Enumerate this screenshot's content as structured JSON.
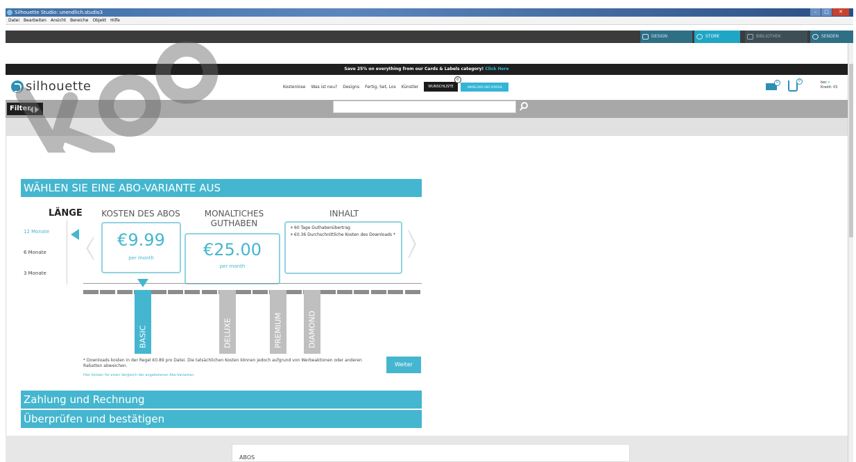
{
  "window": {
    "title": "Silhouette Studio: unendlich.studio3"
  },
  "menubar": [
    "Datei",
    "Bearbeiten",
    "Ansicht",
    "Bereiche",
    "Objekt",
    "Hilfe"
  ],
  "modules": {
    "design": "DESIGN",
    "store": "STORE",
    "library": "BIBLIOTHEK",
    "send": "SENDEN"
  },
  "promo": {
    "text": "Save 25% on everything from our Cards & Labels category!",
    "link": "Click Here"
  },
  "store_header": {
    "logo": "silhouette",
    "nav": [
      "Kostenlose",
      "Was ist neu?",
      "Designs",
      "Fertig, Set, Los",
      "Künstler"
    ],
    "wishlist_label": "WUNSCHLISTE",
    "wishlist_count": "0",
    "login_label": "ANMELDEN UND SPAREN",
    "mail_count": "0",
    "cart_count": "0",
    "user": "bec",
    "credit": "Kredit: €5"
  },
  "filterbar": {
    "filter_label": "Filter",
    "search_value": ""
  },
  "subscription": {
    "heading": "WÄHLEN SIE EINE ABO-VARIANTE AUS",
    "length_label": "LÄNGE",
    "months": [
      "12 Monate",
      "6 Monate",
      "3 Monate"
    ],
    "selected_month_index": 0,
    "col_cost": "KOSTEN DES ABOS",
    "col_monthly_line1": "MONALTICHES",
    "col_monthly_line2": "GUTHABEN",
    "col_content": "INHALT",
    "cost_value": "€9.99",
    "cost_unit": "per month",
    "credit_value": "€25.00",
    "credit_unit": "per month",
    "content_items": [
      "60 Tage Guthabenübertrag",
      "€0.36 Durchschnittliche Kosten des Downloads *"
    ],
    "plans": [
      "BASIC",
      "DELUXE",
      "PREMIUM",
      "DIAMOND"
    ],
    "selected_plan": "BASIC",
    "footnote": "* Downloads kosten in der Regel €0.89 pro Datei. Die tatsächlichen Kosten können jedoch aufgrund von Werbeaktionen oder anderen Rabatten abweichen.",
    "footlink": "Hier klicken für einen Vergleich der angebotenen Abo-Varianten.",
    "continue_label": "Weiter"
  },
  "sections": {
    "payment": "Zahlung und Rechnung",
    "review": "Überprüfen und bestätigen"
  },
  "abos_label": "ABOS",
  "colors": {
    "accent": "#45b6cf",
    "dark": "#1f1f1f",
    "store_tab": "#1fa6c5"
  }
}
